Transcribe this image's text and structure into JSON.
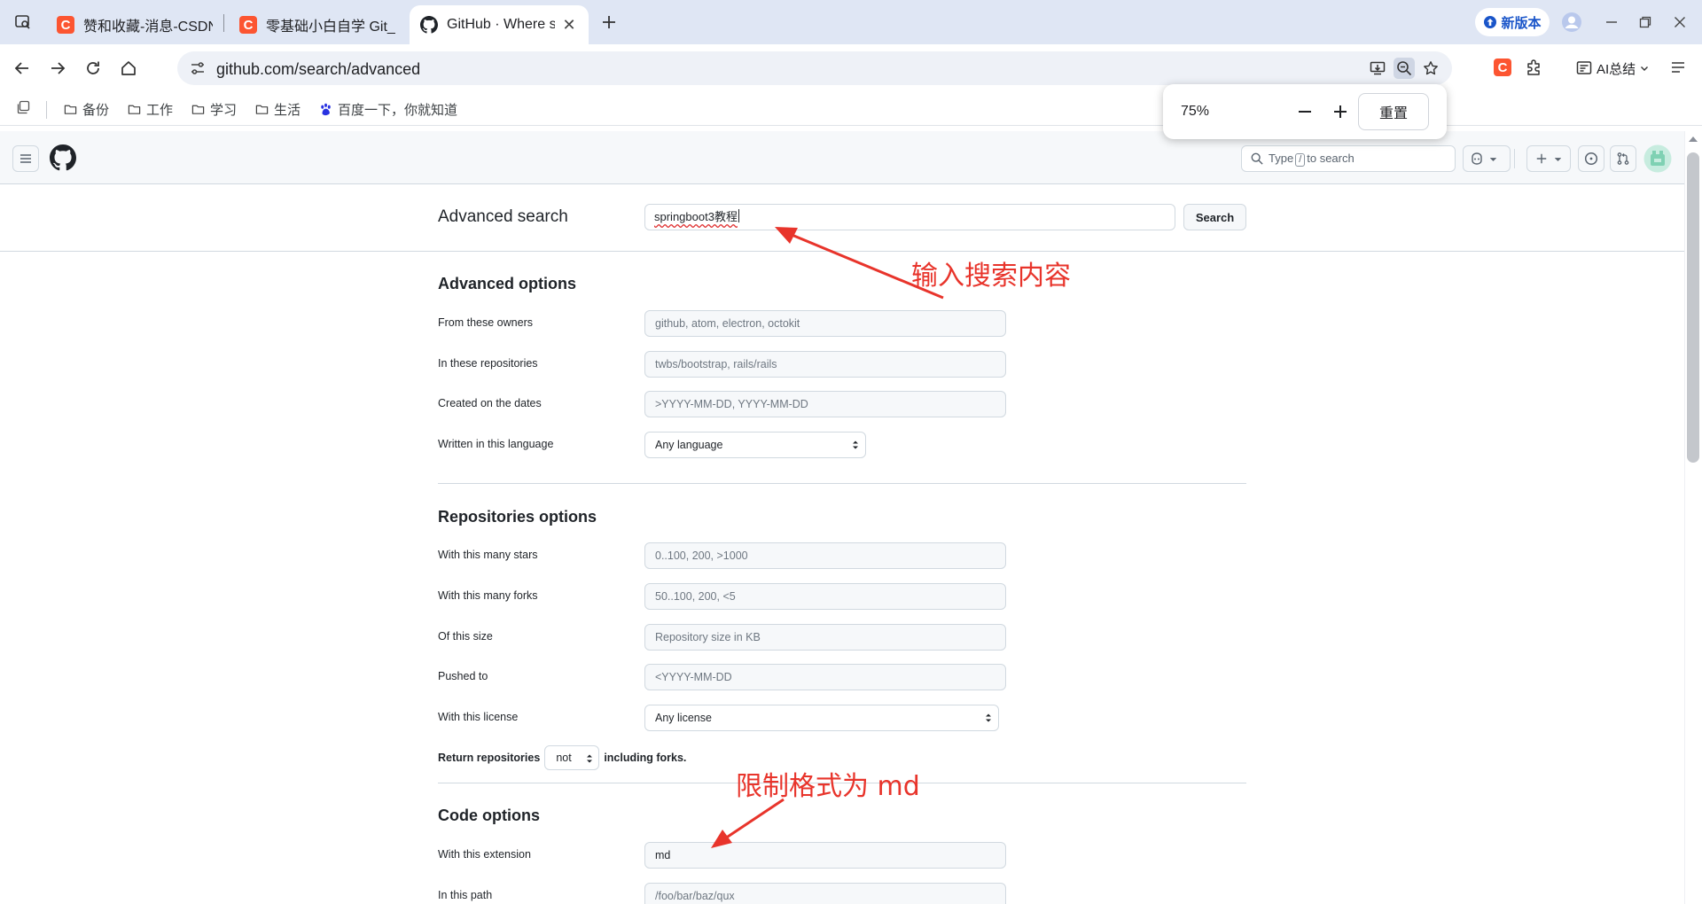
{
  "browser": {
    "tabs": [
      {
        "title": "赞和收藏-消息-CSDN",
        "icon": "csdn-icon"
      },
      {
        "title": "零基础小白自学 Git_Gi",
        "icon": "csdn-icon"
      },
      {
        "title": "GitHub · Where s",
        "icon": "github-icon"
      }
    ],
    "csdn_glyph": "C",
    "new_version_label": "新版本",
    "url": "github.com/search/advanced",
    "ai_summary_label": "AI总结",
    "bookmarks": [
      {
        "label": "备份"
      },
      {
        "label": "工作"
      },
      {
        "label": "学习"
      },
      {
        "label": "生活"
      },
      {
        "label": "百度一下，你就知道"
      }
    ],
    "zoom": {
      "level": "75%",
      "minus": "−",
      "plus": "+",
      "reset_label": "重置"
    }
  },
  "github": {
    "search_placeholder_pre": "Type",
    "search_key": "/",
    "search_placeholder_post": "to search"
  },
  "page": {
    "title": "Advanced search",
    "query": "springboot3教程",
    "search_button": "Search",
    "sections": {
      "advanced": {
        "title": "Advanced options",
        "rows": [
          {
            "label": "From these owners",
            "placeholder": "github, atom, electron, octokit"
          },
          {
            "label": "In these repositories",
            "placeholder": "twbs/bootstrap, rails/rails"
          },
          {
            "label": "Created on the dates",
            "placeholder": ">YYYY-MM-DD, YYYY-MM-DD"
          },
          {
            "label": "Written in this language",
            "value": "Any language"
          }
        ]
      },
      "repos": {
        "title": "Repositories options",
        "rows": [
          {
            "label": "With this many stars",
            "placeholder": "0..100, 200, >1000"
          },
          {
            "label": "With this many forks",
            "placeholder": "50..100, 200, <5"
          },
          {
            "label": "Of this size",
            "placeholder": "Repository size in KB"
          },
          {
            "label": "Pushed to",
            "placeholder": "<YYYY-MM-DD"
          },
          {
            "label": "With this license",
            "value": "Any license"
          }
        ],
        "return_prefix": "Return repositories",
        "return_select": "not",
        "return_suffix": "including forks."
      },
      "code": {
        "title": "Code options",
        "rows": [
          {
            "label": "With this extension",
            "value": "md"
          },
          {
            "label": "In this path",
            "placeholder": "/foo/bar/baz/qux"
          }
        ]
      }
    },
    "annotations": {
      "input_hint": "输入搜索内容",
      "format_hint": "限制格式为 md"
    }
  },
  "colors": {
    "annotation": "#e8342b",
    "csdn": "#fc5531",
    "link": "#1a55c9"
  }
}
